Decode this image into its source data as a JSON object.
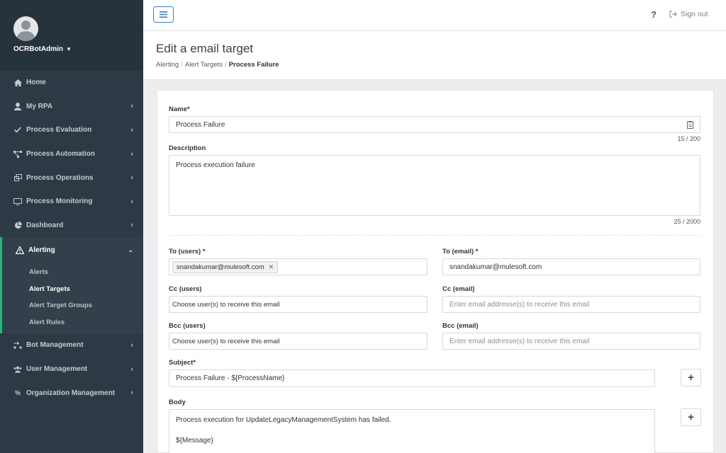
{
  "user": {
    "name": "OCRBotAdmin"
  },
  "nav": {
    "items": [
      {
        "label": "Home",
        "icon": "home-icon"
      },
      {
        "label": "My RPA",
        "icon": "user-icon"
      },
      {
        "label": "Process Evaluation",
        "icon": "check-icon"
      },
      {
        "label": "Process Automation",
        "icon": "nodes-icon"
      },
      {
        "label": "Process Operations",
        "icon": "operations-icon"
      },
      {
        "label": "Process Monitoring",
        "icon": "monitor-icon"
      },
      {
        "label": "Dashboard",
        "icon": "pie-chart-icon"
      }
    ],
    "active": {
      "label": "Alerting",
      "icon": "warning-icon"
    },
    "sub_items": [
      "Alerts",
      "Alert Targets",
      "Alert Target Groups",
      "Alert Rules"
    ],
    "bottom_items": [
      {
        "label": "Bot Management",
        "icon": "bot-icon"
      },
      {
        "label": "User Management",
        "icon": "users-icon"
      },
      {
        "label": "Organization Management",
        "icon": "percent-icon"
      }
    ]
  },
  "topbar": {
    "help": "?",
    "signout": "Sign out"
  },
  "header": {
    "title": "Edit a email target",
    "breadcrumb": [
      "Alerting",
      "Alert Targets",
      "Process Failure"
    ]
  },
  "form": {
    "name_label": "Name*",
    "name_value": "Process Failure",
    "name_counter": "15 / 200",
    "description_label": "Description",
    "description_value": "Process execution failure",
    "description_counter": "25 / 2000",
    "to_users_label": "To (users) *",
    "to_users_chip": "snandakumar@mulesoft.com",
    "to_email_label": "To (email) *",
    "to_email_value": "snandakumar@mulesoft.com",
    "cc_users_label": "Cc (users)",
    "cc_users_placeholder": "Choose user(s) to receive this email",
    "cc_email_label": "Cc (email)",
    "cc_email_placeholder": "Enter email addresse(s) to receive this email",
    "bcc_users_label": "Bcc (users)",
    "bcc_users_placeholder": "Choose user(s) to receive this email",
    "bcc_email_label": "Bcc (email)",
    "bcc_email_placeholder": "Enter email addresse(s) to receive this email",
    "subject_label": "Subject*",
    "subject_value": "Process Failure - ${ProcessName}",
    "body_label": "Body",
    "body_line1": "Process execution for UpdateLegacyManagementSystem has failed.",
    "body_line2": "${Message}",
    "plus": "+"
  },
  "colors": {
    "sidebar": "#2d3a45",
    "accent_green": "#2ab27b",
    "accent_blue": "#3c7cc2"
  }
}
